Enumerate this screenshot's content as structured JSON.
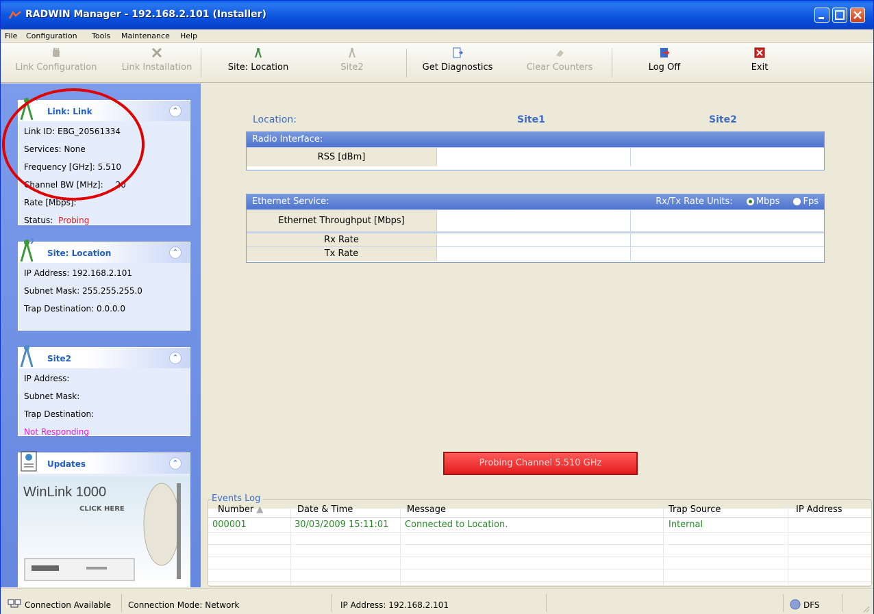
{
  "window": {
    "title": "RADWIN Manager - 192.168.2.101 (Installer)"
  },
  "menu": {
    "items": [
      "File",
      "Configuration",
      "Tools",
      "Maintenance",
      "Help"
    ]
  },
  "toolbar": {
    "link_configuration": "Link Configuration",
    "link_installation": "Link Installation",
    "site_location": "Site: Location",
    "site2": "Site2",
    "get_diagnostics": "Get Diagnostics",
    "clear_counters": "Clear Counters",
    "log_off": "Log Off",
    "exit": "Exit"
  },
  "link_panel": {
    "title": "Link: Link",
    "link_id": "Link ID:  EBG_20561334",
    "services": "Services:  None",
    "frequency": "Frequency [GHz]:  5.510",
    "channel_bw_label": "Channel BW [MHz]:",
    "channel_bw_value": "20",
    "rate": "Rate [Mbps]:",
    "status_label": "Status:",
    "status_value": "Probing"
  },
  "site_location_panel": {
    "title": "Site: Location",
    "ip": "IP Address:  192.168.2.101",
    "subnet": "Subnet Mask:  255.255.255.0",
    "trap": "Trap Destination:  0.0.0.0"
  },
  "site2_panel": {
    "title": "Site2",
    "ip": "IP Address:",
    "subnet": "Subnet Mask:",
    "trap": "Trap Destination:",
    "status": "Not Responding"
  },
  "updates_panel": {
    "title": "Updates",
    "ad_title": "WinLink 1000",
    "ad_sub": "CLICK HERE"
  },
  "main": {
    "location_label": "Location:",
    "site1": "Site1",
    "site2": "Site2",
    "radio_interface": "Radio Interface:",
    "rss": "RSS [dBm]",
    "ethernet_service": "Ethernet Service:",
    "rate_units_label": "Rx/Tx Rate Units:",
    "rate_unit_mbps": "Mbps",
    "rate_unit_fps": "Fps",
    "rate_unit_selected": "Mbps",
    "ethernet_throughput": "Ethernet Throughput [Mbps]",
    "rx_rate": "Rx Rate",
    "tx_rate": "Tx Rate",
    "probing_button": "Probing Channel 5.510 GHz"
  },
  "events_log": {
    "title": "Events Log",
    "columns": [
      "Number",
      "Date & Time",
      "Message",
      "Trap Source",
      "IP Address"
    ],
    "rows": [
      {
        "number": "000001",
        "datetime": "30/03/2009 15:11:01",
        "message": "Connected to Location.",
        "trap_source": "Internal",
        "ip": ""
      }
    ]
  },
  "statusbar": {
    "connection": "Connection Available",
    "mode": "Connection Mode: Network",
    "ip": "IP Address: 192.168.2.101",
    "dfs": "DFS"
  },
  "colors": {
    "status_probing": "#e02020",
    "not_responding": "#e020e0",
    "panel_title": "#215dc6",
    "annotation_circle": "#e00000"
  }
}
